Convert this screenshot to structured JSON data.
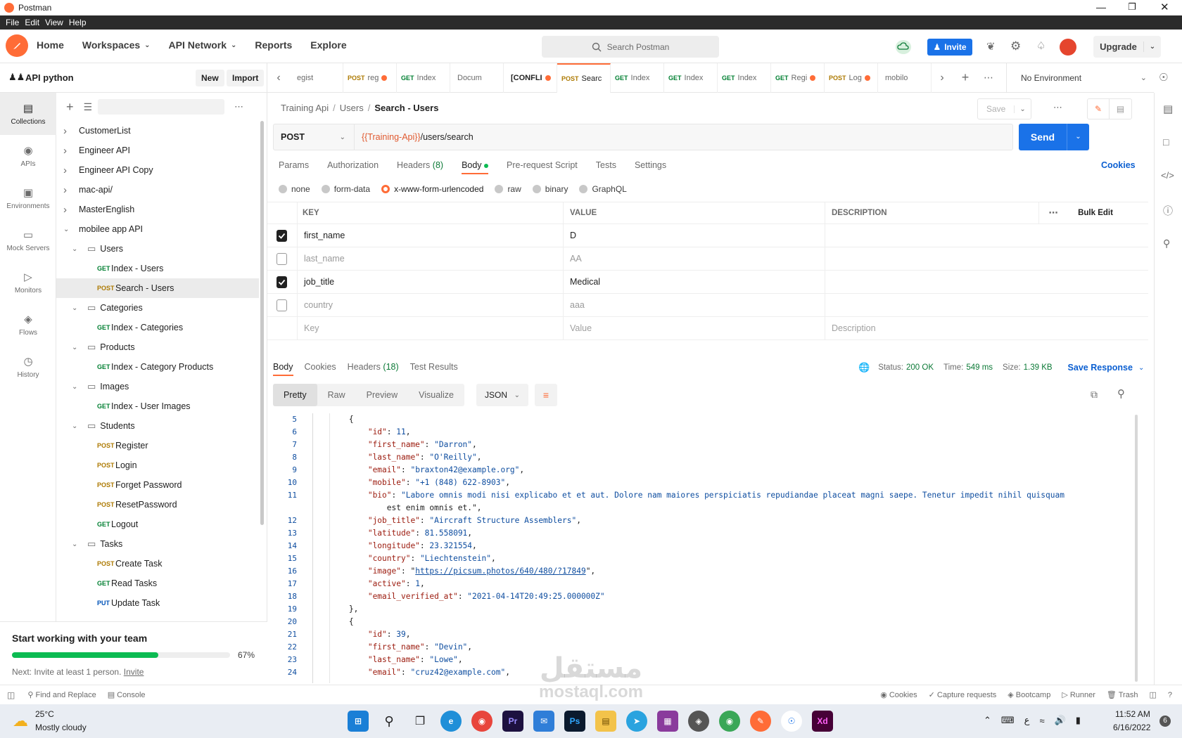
{
  "window": {
    "title": "Postman"
  },
  "menu": [
    "File",
    "Edit",
    "View",
    "Help"
  ],
  "header": {
    "home": "Home",
    "workspaces": "Workspaces",
    "api_network": "API Network",
    "reports": "Reports",
    "explore": "Explore",
    "search_placeholder": "Search Postman",
    "invite": "Invite",
    "upgrade": "Upgrade"
  },
  "workspace": {
    "name": "API python",
    "new": "New",
    "import": "Import"
  },
  "tabs": [
    {
      "method": "",
      "label": "egist",
      "dot": false
    },
    {
      "method": "POST",
      "label": "reg",
      "dot": true
    },
    {
      "method": "GET",
      "label": "Index",
      "dot": false
    },
    {
      "method": "",
      "label": "Docum",
      "dot": false
    },
    {
      "method": "",
      "label": "[CONFLI",
      "dot": true
    },
    {
      "method": "POST",
      "label": "Searc",
      "dot": false
    },
    {
      "method": "GET",
      "label": "Index",
      "dot": false
    },
    {
      "method": "GET",
      "label": "Index",
      "dot": false
    },
    {
      "method": "GET",
      "label": "Index",
      "dot": false
    },
    {
      "method": "GET",
      "label": "Regi",
      "dot": true
    },
    {
      "method": "POST",
      "label": "Log",
      "dot": true
    },
    {
      "method": "",
      "label": "mobilo",
      "dot": false
    }
  ],
  "environment": "No Environment",
  "rail": [
    "Collections",
    "APIs",
    "Environments",
    "Mock Servers",
    "Monitors",
    "Flows",
    "History"
  ],
  "tree": [
    {
      "depth": 0,
      "type": "coll",
      "open": false,
      "label": "CustomerList"
    },
    {
      "depth": 0,
      "type": "coll",
      "open": false,
      "label": "Engineer API"
    },
    {
      "depth": 0,
      "type": "coll",
      "open": false,
      "label": "Engineer API Copy"
    },
    {
      "depth": 0,
      "type": "coll",
      "open": false,
      "label": "mac-api/"
    },
    {
      "depth": 0,
      "type": "coll",
      "open": false,
      "label": "MasterEnglish"
    },
    {
      "depth": 0,
      "type": "coll",
      "open": true,
      "label": "mobilee app API"
    },
    {
      "depth": 1,
      "type": "folder",
      "open": true,
      "label": "Users"
    },
    {
      "depth": 2,
      "type": "req",
      "method": "GET",
      "label": "Index - Users"
    },
    {
      "depth": 2,
      "type": "req",
      "method": "POST",
      "label": "Search - Users",
      "selected": true
    },
    {
      "depth": 1,
      "type": "folder",
      "open": true,
      "label": "Categories"
    },
    {
      "depth": 2,
      "type": "req",
      "method": "GET",
      "label": "Index - Categories"
    },
    {
      "depth": 1,
      "type": "folder",
      "open": true,
      "label": "Products"
    },
    {
      "depth": 2,
      "type": "req",
      "method": "GET",
      "label": "Index - Category Products"
    },
    {
      "depth": 1,
      "type": "folder",
      "open": true,
      "label": "Images"
    },
    {
      "depth": 2,
      "type": "req",
      "method": "GET",
      "label": "Index - User Images"
    },
    {
      "depth": 1,
      "type": "folder",
      "open": true,
      "label": "Students"
    },
    {
      "depth": 2,
      "type": "req",
      "method": "POST",
      "label": "Register"
    },
    {
      "depth": 2,
      "type": "req",
      "method": "POST",
      "label": "Login"
    },
    {
      "depth": 2,
      "type": "req",
      "method": "POST",
      "label": "Forget Password"
    },
    {
      "depth": 2,
      "type": "req",
      "method": "POST",
      "label": "ResetPassword"
    },
    {
      "depth": 2,
      "type": "req",
      "method": "GET",
      "label": "Logout"
    },
    {
      "depth": 1,
      "type": "folder",
      "open": true,
      "label": "Tasks"
    },
    {
      "depth": 2,
      "type": "req",
      "method": "POST",
      "label": "Create Task"
    },
    {
      "depth": 2,
      "type": "req",
      "method": "GET",
      "label": "Read Tasks"
    },
    {
      "depth": 2,
      "type": "req",
      "method": "PUT",
      "label": "Update Task"
    }
  ],
  "promo": {
    "title": "Start working with your team",
    "percent": "67%",
    "progress": 0.67,
    "next": "Next: Invite at least 1 person.",
    "invite_link": "Invite"
  },
  "breadcrumb": {
    "a": "Training Api",
    "b": "Users",
    "c": "Search - Users"
  },
  "save": "Save",
  "request": {
    "method": "POST",
    "url_var": "{{Training-Api}}",
    "url_path": "/users/search",
    "send": "Send"
  },
  "req_tabs": {
    "params": "Params",
    "auth": "Authorization",
    "headers": "Headers",
    "headers_count": "(8)",
    "body": "Body",
    "prereq": "Pre-request Script",
    "tests": "Tests",
    "settings": "Settings",
    "cookies": "Cookies"
  },
  "body_types": [
    "none",
    "form-data",
    "x-www-form-urlencoded",
    "raw",
    "binary",
    "GraphQL"
  ],
  "kv": {
    "h_key": "KEY",
    "h_value": "VALUE",
    "h_desc": "DESCRIPTION",
    "bulk": "Bulk Edit",
    "rows": [
      {
        "checked": true,
        "key": "first_name",
        "value": "D"
      },
      {
        "checked": false,
        "key": "last_name",
        "value": "AA"
      },
      {
        "checked": true,
        "key": "job_title",
        "value": "Medical"
      },
      {
        "checked": false,
        "key": "country",
        "value": "aaa"
      }
    ],
    "ph_key": "Key",
    "ph_value": "Value",
    "ph_desc": "Description"
  },
  "response": {
    "body": "Body",
    "cookies": "Cookies",
    "headers": "Headers",
    "headers_count": "(18)",
    "tests": "Test Results",
    "status_label": "Status:",
    "status": "200 OK",
    "time_label": "Time:",
    "time": "549 ms",
    "size_label": "Size:",
    "size": "1.39 KB",
    "save": "Save Response",
    "views": [
      "Pretty",
      "Raw",
      "Preview",
      "Visualize"
    ],
    "format": "JSON"
  },
  "code_lines": [
    {
      "n": "5",
      "t": "        {"
    },
    {
      "n": "6",
      "t": "            \"id\": 11,"
    },
    {
      "n": "7",
      "t": "            \"first_name\": \"Darron\","
    },
    {
      "n": "8",
      "t": "            \"last_name\": \"O'Reilly\","
    },
    {
      "n": "9",
      "t": "            \"email\": \"braxton42@example.org\","
    },
    {
      "n": "10",
      "t": "            \"mobile\": \"+1 (848) 622-8903\","
    },
    {
      "n": "11",
      "t": "            \"bio\": \"Labore omnis modi nisi explicabo et et aut. Dolore nam maiores perspiciatis repudiandae placeat magni saepe. Tenetur impedit nihil quisquam"
    },
    {
      "n": "",
      "t": "                est enim omnis et.\","
    },
    {
      "n": "12",
      "t": "            \"job_title\": \"Aircraft Structure Assemblers\","
    },
    {
      "n": "13",
      "t": "            \"latitude\": 81.558091,"
    },
    {
      "n": "14",
      "t": "            \"longitude\": 23.321554,"
    },
    {
      "n": "15",
      "t": "            \"country\": \"Liechtenstein\","
    },
    {
      "n": "16",
      "t": "            \"image\": \"https://picsum.photos/640/480/?17849\","
    },
    {
      "n": "17",
      "t": "            \"active\": 1,"
    },
    {
      "n": "18",
      "t": "            \"email_verified_at\": \"2021-04-14T20:49:25.000000Z\""
    },
    {
      "n": "19",
      "t": "        },"
    },
    {
      "n": "20",
      "t": "        {"
    },
    {
      "n": "21",
      "t": "            \"id\": 39,"
    },
    {
      "n": "22",
      "t": "            \"first_name\": \"Devin\","
    },
    {
      "n": "23",
      "t": "            \"last_name\": \"Lowe\","
    },
    {
      "n": "24",
      "t": "            \"email\": \"cruz42@example.com\","
    }
  ],
  "statusbar": {
    "find": "Find and Replace",
    "console": "Console",
    "cookies": "Cookies",
    "capture": "Capture requests",
    "bootcamp": "Bootcamp",
    "runner": "Runner",
    "trash": "Trash"
  },
  "taskbar": {
    "temp": "25°C",
    "weather": "Mostly cloudy",
    "time": "11:52 AM",
    "date": "6/16/2022",
    "lang": "ع",
    "notif": "6"
  },
  "watermark": {
    "arabic": "مستقل",
    "latin": "mostaql.com"
  }
}
